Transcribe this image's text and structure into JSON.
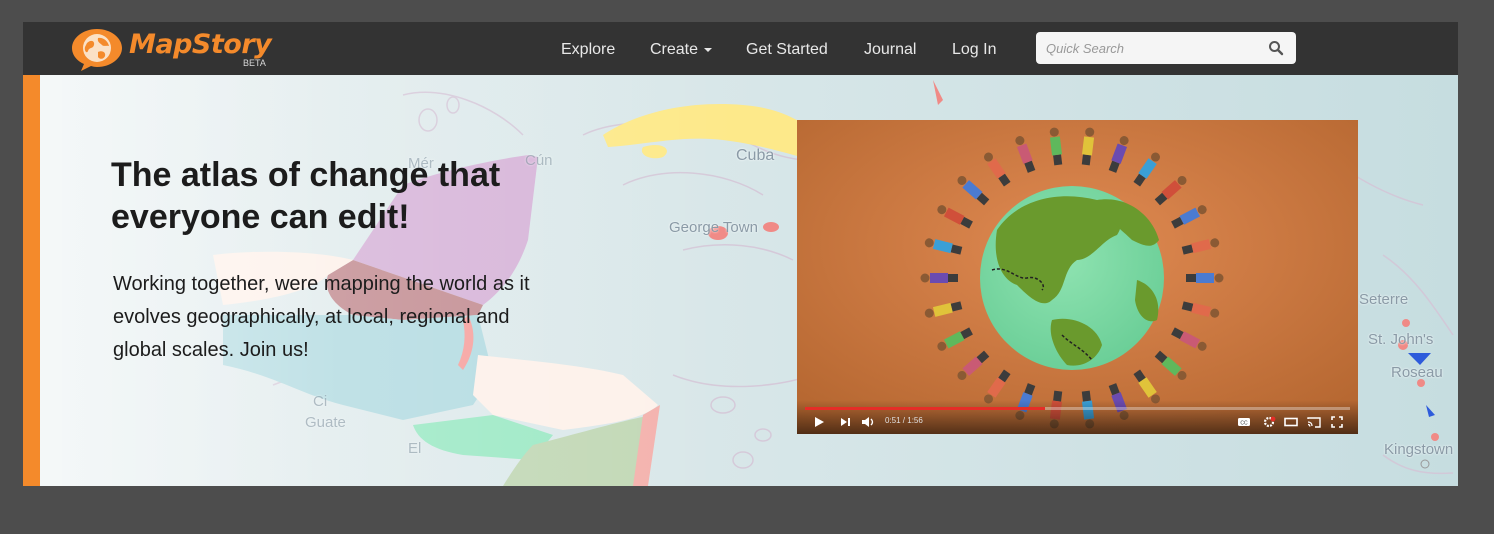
{
  "brand": {
    "name": "MapStory",
    "badge": "BETA",
    "accent_color": "#f48a2b"
  },
  "nav": {
    "items": [
      {
        "label": "Explore"
      },
      {
        "label": "Create",
        "has_dropdown": true
      },
      {
        "label": "Get Started"
      },
      {
        "label": "Journal"
      },
      {
        "label": "Log In"
      }
    ],
    "search": {
      "placeholder": "Quick Search",
      "icon": "search-icon"
    }
  },
  "hero": {
    "headline": "The atlas of change that everyone can edit!",
    "tagline": "Working together, were mapping the world as it evolves geographically, at local, regional and global scales. Join us!"
  },
  "map_labels": [
    "Cuba",
    "George Town",
    "Mér",
    "Cún",
    "Ci",
    "Guate",
    "El",
    "Seterre",
    "St. John's",
    "Roseau",
    "Kingstown"
  ],
  "video": {
    "time": "0:51 / 1:56",
    "progress": 0.44,
    "controls": [
      "play-icon",
      "next-icon",
      "volume-icon",
      "captions-icon",
      "settings-icon",
      "theater-icon",
      "cast-icon",
      "fullscreen-icon"
    ]
  }
}
